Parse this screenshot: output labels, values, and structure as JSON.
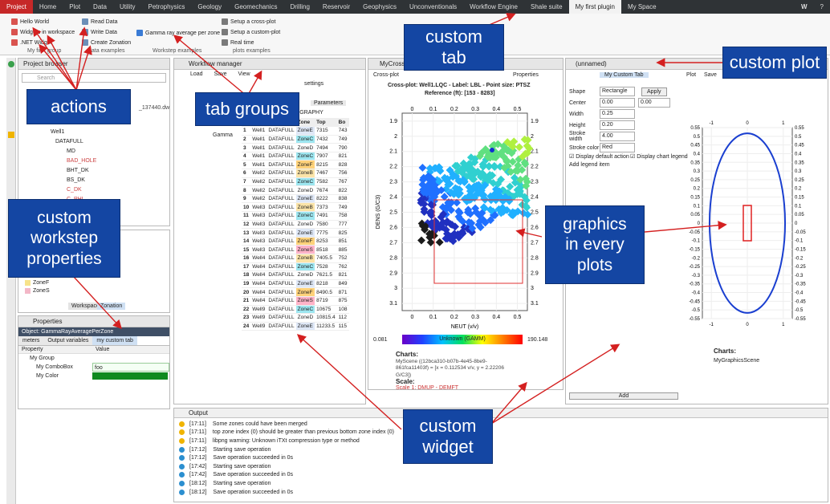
{
  "menubar": {
    "tabs": [
      "Project",
      "Home",
      "Plot",
      "Data",
      "Utility",
      "Petrophysics",
      "Geology",
      "Geomechanics",
      "Drilling",
      "Reservoir",
      "Geophysics",
      "Unconventionals",
      "Workflow Engine",
      "Shale suite",
      "My first plugin",
      "My Space"
    ],
    "right": "W"
  },
  "ribbon": {
    "actions": [
      "Hello World",
      "Widgets in workspace",
      ".NET Widget"
    ],
    "data_examples": [
      "Read Data",
      "Write Data",
      "Create Zonation"
    ],
    "workstep": "Gamma ray average per zone",
    "plots": [
      "Setup a cross-plot",
      "Setup a custom-plot",
      "Real time"
    ],
    "groups": [
      "My first group",
      "data examples",
      "Workstep examples",
      "plots examples"
    ]
  },
  "project_browser": {
    "title": "Project browser",
    "search_placeholder": "Search",
    "items": [
      "Well1",
      "DATAFULL",
      "MD",
      "BAD_HOLE",
      "BHT_DK",
      "BS_DK",
      "C_DK",
      "C_PHI"
    ],
    "file_suffix": "_137440.dw"
  },
  "zonation": {
    "items": [
      "ZoneF",
      "ZoneS"
    ],
    "tabs": [
      "Workspace",
      "Zonation"
    ]
  },
  "properties": {
    "title": "Properties",
    "object": "Object: GammaRayAveragePerZone",
    "tabs": [
      "meters",
      "Output variables",
      "my custom tab"
    ],
    "headers": [
      "Property",
      "Value"
    ],
    "rows": [
      {
        "name": "My Group",
        "value": ""
      },
      {
        "name": "My ComboBox",
        "value": "foo"
      },
      {
        "name": "My Color",
        "value": ""
      }
    ]
  },
  "workflow": {
    "title": "Workflow manager",
    "menu": [
      "Load",
      "Save",
      "View"
    ],
    "settings_label": "settings",
    "params_tab": "Parameters",
    "strat_label": "TIGRAPHY",
    "node": "Gamma",
    "headers": [
      "",
      "Zone",
      "Top",
      "Bo"
    ],
    "rows": [
      [
        "1",
        "Well1",
        "DATAFULL",
        "ZoneE",
        "7315",
        "743"
      ],
      [
        "2",
        "Well1",
        "DATAFULL",
        "ZoneC",
        "7432",
        "749"
      ],
      [
        "3",
        "Well1",
        "DATAFULL",
        "ZoneD",
        "7494",
        "790"
      ],
      [
        "4",
        "Well1",
        "DATAFULL",
        "ZoneC",
        "7907",
        "821"
      ],
      [
        "5",
        "Well1",
        "DATAFULL",
        "ZoneF",
        "8215",
        "828"
      ],
      [
        "6",
        "Well2",
        "DATAFULL",
        "ZoneB",
        "7467",
        "756"
      ],
      [
        "7",
        "Well2",
        "DATAFULL",
        "ZoneC",
        "7582",
        "767"
      ],
      [
        "8",
        "Well2",
        "DATAFULL",
        "ZoneD",
        "7674",
        "822"
      ],
      [
        "9",
        "Well2",
        "DATAFULL",
        "ZoneE",
        "8222",
        "838"
      ],
      [
        "10",
        "Well3",
        "DATAFULL",
        "ZoneB",
        "7373",
        "749"
      ],
      [
        "11",
        "Well3",
        "DATAFULL",
        "ZoneC",
        "7491",
        "758"
      ],
      [
        "12",
        "Well3",
        "DATAFULL",
        "ZoneD",
        "7580",
        "777"
      ],
      [
        "13",
        "Well3",
        "DATAFULL",
        "ZoneE",
        "7775",
        "825"
      ],
      [
        "14",
        "Well3",
        "DATAFULL",
        "ZoneF",
        "8253",
        "851"
      ],
      [
        "15",
        "Well3",
        "DATAFULL",
        "ZoneS",
        "8518",
        "885"
      ],
      [
        "16",
        "Well4",
        "DATAFULL",
        "ZoneB",
        "7405.5",
        "752"
      ],
      [
        "17",
        "Well4",
        "DATAFULL",
        "ZoneC",
        "7528",
        "762"
      ],
      [
        "18",
        "Well4",
        "DATAFULL",
        "ZoneD",
        "7621.5",
        "821"
      ],
      [
        "19",
        "Well4",
        "DATAFULL",
        "ZoneE",
        "8218",
        "849"
      ],
      [
        "20",
        "Well4",
        "DATAFULL",
        "ZoneF",
        "8490.5",
        "871"
      ],
      [
        "21",
        "Well4",
        "DATAFULL",
        "ZoneS",
        "8719",
        "875"
      ],
      [
        "22",
        "Well9",
        "DATAFULL",
        "ZoneC",
        "10675",
        "108"
      ],
      [
        "23",
        "Well9",
        "DATAFULL",
        "ZoneD",
        "10815.4",
        "112"
      ],
      [
        "24",
        "Well9",
        "DATAFULL",
        "ZoneE",
        "11233.5",
        "115"
      ]
    ]
  },
  "crossplot": {
    "tab_title": "MyCrossP",
    "toolbar": "Cross-plot",
    "props": "Properties",
    "title": "Cross-plot: Well1.LQC  -  Label: LBL  -  Point size: PTSZ",
    "subtitle": "Reference (ft): [153 - 8283]",
    "xlabel": "NEUT (v/v)",
    "ylabel": "DENS (G/C3)",
    "xticks": [
      "0",
      "0.1",
      "0.2",
      "0.3",
      "0.4",
      "0.5"
    ],
    "yticks": [
      "1.9",
      "2",
      "2.1",
      "2.2",
      "2.3",
      "2.4",
      "2.5",
      "2.6",
      "2.7",
      "2.8",
      "2.9",
      "3",
      "3.1"
    ],
    "color_min": "0.081",
    "color_max": "190.148",
    "color_label": "Unknown (GAMM)",
    "charts_label": "Charts:",
    "scene": "MyScene ((12bca310-b07b-4e45-8be9-861fca11403f) = [x = 0.112534 v/v, y = 2.22206 G/C3])",
    "scale_label": "Scale:",
    "scale_text": "Scale 1: DMUP - DEMFT"
  },
  "custom_plot": {
    "tab": "(unnamed)",
    "custom_tab": "My Custom Tab",
    "fields": [
      {
        "label": "Shape",
        "value": "Rectangle"
      },
      {
        "label": "Center",
        "value": "0.00"
      },
      {
        "label": "Width",
        "value": "0.25"
      },
      {
        "label": "Height",
        "value": "0.20"
      },
      {
        "label": "Stroke width",
        "value": "4.00"
      },
      {
        "label": "Stroke color",
        "value": "Red"
      }
    ],
    "center_y": "0.00",
    "apply": "Apply",
    "chk1": "Display default action",
    "chk2": "Display chart legend",
    "legend_label": "Add legend item",
    "add": "Add",
    "plot_menu": [
      "Plot",
      "Save"
    ],
    "charts_label": "Charts:",
    "scene": "MyGraphicsScene",
    "yticks": [
      "0.55",
      "0.5",
      "0.45",
      "0.4",
      "0.35",
      "0.3",
      "0.25",
      "0.2",
      "0.15",
      "0.1",
      "0.05",
      "0",
      "-0.05",
      "-0.1",
      "-0.15",
      "-0.2",
      "-0.25",
      "-0.3",
      "-0.35",
      "-0.4",
      "-0.45",
      "-0.5",
      "-0.55"
    ],
    "xticks": [
      "-1",
      "0",
      "1"
    ]
  },
  "output": {
    "title": "Output",
    "lines": [
      {
        "t": "[17:11]",
        "m": "Some zones could have been merged",
        "c": "#f0b400"
      },
      {
        "t": "[17:11]",
        "m": "top zone index (0) should be greater than previous bottom zone index (0)",
        "c": "#f0b400"
      },
      {
        "t": "[17:11]",
        "m": "libpng warning: Unknown iTXt compression type or method",
        "c": "#f0b400"
      },
      {
        "t": "[17:12]",
        "m": "Starting save operation",
        "c": "#2b8fd0"
      },
      {
        "t": "[17:12]",
        "m": "Save operation succeeded in 0s",
        "c": "#2b8fd0"
      },
      {
        "t": "[17:42]",
        "m": "Starting save operation",
        "c": "#2b8fd0"
      },
      {
        "t": "[17:42]",
        "m": "Save operation succeeded in 0s",
        "c": "#2b8fd0"
      },
      {
        "t": "[18:12]",
        "m": "Starting save operation",
        "c": "#2b8fd0"
      },
      {
        "t": "[18:12]",
        "m": "Save operation succeeded in 0s",
        "c": "#2b8fd0"
      }
    ]
  },
  "callouts": {
    "actions": "actions",
    "tab_groups": "tab groups",
    "custom_tab": "custom\ntab",
    "custom_plot": "custom plot",
    "custom_workstep": "custom\nworkstep\nproperties",
    "graphics": "graphics\nin every\nplots",
    "custom_widget": "custom\nwidget"
  },
  "colors": {
    "callout": "#1446a3",
    "arrow": "#d42020",
    "accent": "#c62828"
  }
}
